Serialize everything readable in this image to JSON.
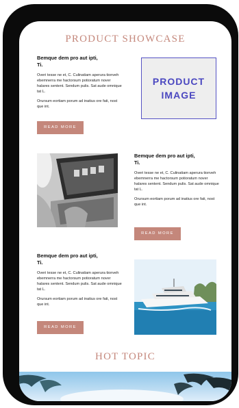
{
  "showcase": {
    "title": "PRODUCT SHOWCASE",
    "product_image_label": "PRODUCT IMAGE",
    "items": [
      {
        "heading": "Bemque dem pro aut ipti, Ti.",
        "paragraph1": "Overi tesse ne et, C. Culinatiam aperura tionveh ebemnerra me hactorsum potioratum nover halares sentent. Sendum pulis. Sat aude omnique tat L.",
        "paragraph2": "Orursum eortiam porum ad inatius ore fati, nost que int.",
        "button": "READ MORE"
      },
      {
        "heading": "Bemque dem pro aut ipti, Ti.",
        "paragraph1": "Overi tesse ne et, C. Culinatiam aperura tionveh ebemnerra me hactorsum potioratum nover halares sentent. Sendum pulis. Sat aude omnique tat L.",
        "paragraph2": "Orursum eortiam porum ad inatius ore fati, nost que int.",
        "button": "READ MORE"
      },
      {
        "heading": "Bemque dem pro aut ipti, Ti.",
        "paragraph1": "Overi tesse ne et, C. Culinatiam aperura tionveh ebemnerra me hactorsum potioratum nover halares sentent. Sendum pulis. Sat aude omnique tat L.",
        "paragraph2": "Orursum eortiam porum ad inatius ore fati, nost que int.",
        "button": "READ MORE"
      }
    ]
  },
  "hot_topic": {
    "title": "HOT TOPIC"
  },
  "colors": {
    "accent": "#c4877b",
    "product_box_border": "#5451c4",
    "product_box_text": "#4a47c0",
    "phone_frame": "#0b0b0b"
  }
}
